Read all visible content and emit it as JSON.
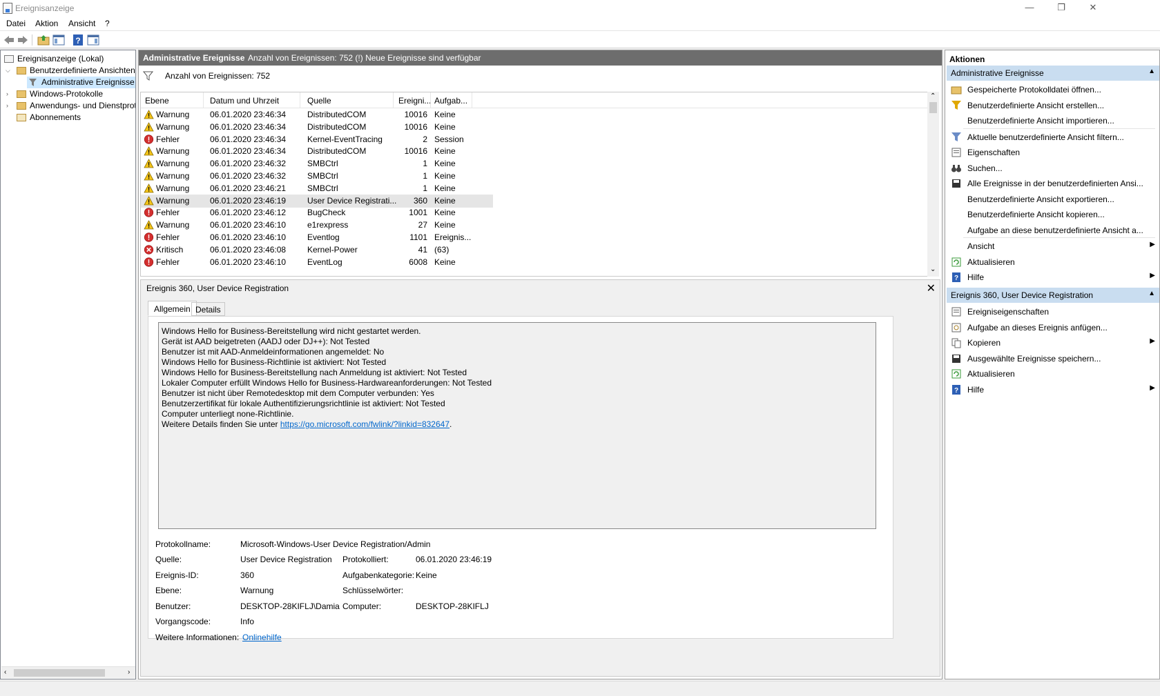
{
  "window": {
    "title": "Ereignisanzeige",
    "minimize": "—",
    "restore": "❐",
    "close": "✕"
  },
  "menu": [
    "Datei",
    "Aktion",
    "Ansicht",
    "?"
  ],
  "tree": {
    "root": "Ereignisanzeige (Lokal)",
    "custom_views": "Benutzerdefinierte Ansichten",
    "admin_events": "Administrative Ereignisse",
    "windows_logs": "Windows-Protokolle",
    "app_logs": "Anwendungs- und Dienstprotokolle",
    "subscriptions": "Abonnements"
  },
  "center": {
    "header_title": "Administrative Ereignisse",
    "header_info": "Anzahl von Ereignissen: 752 (!) Neue Ereignisse sind verfügbar",
    "filter_text": "Anzahl von Ereignissen: 752",
    "columns": [
      "Ebene",
      "Datum und Uhrzeit",
      "Quelle",
      "Ereigni...",
      "Aufgab..."
    ],
    "rows": [
      {
        "level": "Warnung",
        "type": "warn",
        "date": "06.01.2020 23:46:34",
        "source": "DistributedCOM",
        "id": "10016",
        "task": "Keine"
      },
      {
        "level": "Warnung",
        "type": "warn",
        "date": "06.01.2020 23:46:34",
        "source": "DistributedCOM",
        "id": "10016",
        "task": "Keine"
      },
      {
        "level": "Fehler",
        "type": "err",
        "date": "06.01.2020 23:46:34",
        "source": "Kernel-EventTracing",
        "id": "2",
        "task": "Session"
      },
      {
        "level": "Warnung",
        "type": "warn",
        "date": "06.01.2020 23:46:34",
        "source": "DistributedCOM",
        "id": "10016",
        "task": "Keine"
      },
      {
        "level": "Warnung",
        "type": "warn",
        "date": "06.01.2020 23:46:32",
        "source": "SMBCtrl",
        "id": "1",
        "task": "Keine"
      },
      {
        "level": "Warnung",
        "type": "warn",
        "date": "06.01.2020 23:46:32",
        "source": "SMBCtrl",
        "id": "1",
        "task": "Keine"
      },
      {
        "level": "Warnung",
        "type": "warn",
        "date": "06.01.2020 23:46:21",
        "source": "SMBCtrl",
        "id": "1",
        "task": "Keine"
      },
      {
        "level": "Warnung",
        "type": "warn",
        "date": "06.01.2020 23:46:19",
        "source": "User Device Registrati...",
        "id": "360",
        "task": "Keine"
      },
      {
        "level": "Fehler",
        "type": "err",
        "date": "06.01.2020 23:46:12",
        "source": "BugCheck",
        "id": "1001",
        "task": "Keine"
      },
      {
        "level": "Warnung",
        "type": "warn",
        "date": "06.01.2020 23:46:10",
        "source": "e1rexpress",
        "id": "27",
        "task": "Keine"
      },
      {
        "level": "Fehler",
        "type": "err",
        "date": "06.01.2020 23:46:10",
        "source": "Eventlog",
        "id": "1101",
        "task": "Ereignis..."
      },
      {
        "level": "Kritisch",
        "type": "crit",
        "date": "06.01.2020 23:46:08",
        "source": "Kernel-Power",
        "id": "41",
        "task": "(63)"
      },
      {
        "level": "Fehler",
        "type": "err",
        "date": "06.01.2020 23:46:10",
        "source": "EventLog",
        "id": "6008",
        "task": "Keine"
      }
    ]
  },
  "detail": {
    "title": "Ereignis 360, User Device Registration",
    "close": "✕",
    "tabs": [
      "Allgemein",
      "Details"
    ],
    "message": [
      "Windows Hello for Business-Bereitstellung wird nicht gestartet werden.",
      "Gerät ist AAD beigetreten (AADJ oder DJ++): Not Tested",
      "Benutzer ist mit AAD-Anmeldeinformationen angemeldet: No",
      "Windows Hello for Business-Richtlinie ist aktiviert: Not Tested",
      "Windows Hello for Business-Bereitstellung nach Anmeldung ist aktiviert: Not Tested",
      "Lokaler Computer erfüllt Windows Hello for Business-Hardwareanforderungen: Not Tested",
      "Benutzer ist nicht über Remotedesktop mit dem Computer verbunden: Yes",
      "Benutzerzertifikat für lokale Authentifizierungsrichtlinie ist aktiviert: Not Tested",
      "Computer unterliegt none-Richtlinie."
    ],
    "message_link_prefix": "Weitere Details finden Sie unter ",
    "message_link": "https://go.microsoft.com/fwlink/?linkid=832647",
    "message_link_suffix": ".",
    "props": {
      "logname_label": "Protokollname:",
      "logname": "Microsoft-Windows-User Device Registration/Admin",
      "source_label": "Quelle:",
      "source": "User Device Registration",
      "logged_label": "Protokolliert:",
      "logged": "06.01.2020 23:46:19",
      "eventid_label": "Ereignis-ID:",
      "eventid": "360",
      "taskcat_label": "Aufgabenkategorie:",
      "taskcat": "Keine",
      "level_label": "Ebene:",
      "level": "Warnung",
      "keywords_label": "Schlüsselwörter:",
      "user_label": "Benutzer:",
      "user": "DESKTOP-28KIFLJ\\Damia",
      "computer_label": "Computer:",
      "computer": "DESKTOP-28KIFLJ",
      "opcode_label": "Vorgangscode:",
      "opcode": "Info",
      "moreinfo_label": "Weitere Informationen:",
      "moreinfo": "Onlinehilfe"
    }
  },
  "actions": {
    "title": "Aktionen",
    "section1": "Administrative Ereignisse",
    "items1": [
      "Gespeicherte Protokolldatei öffnen...",
      "Benutzerdefinierte Ansicht erstellen...",
      "Benutzerdefinierte Ansicht importieren...",
      "Aktuelle benutzerdefinierte Ansicht filtern...",
      "Eigenschaften",
      "Suchen...",
      "Alle Ereignisse in der benutzerdefinierten Ansi...",
      "Benutzerdefinierte Ansicht exportieren...",
      "Benutzerdefinierte Ansicht kopieren...",
      "Aufgabe an diese benutzerdefinierte Ansicht a...",
      "Ansicht",
      "Aktualisieren",
      "Hilfe"
    ],
    "section2": "Ereignis 360, User Device Registration",
    "items2": [
      "Ereigniseigenschaften",
      "Aufgabe an dieses Ereignis anfügen...",
      "Kopieren",
      "Ausgewählte Ereignisse speichern...",
      "Aktualisieren",
      "Hilfe"
    ]
  }
}
